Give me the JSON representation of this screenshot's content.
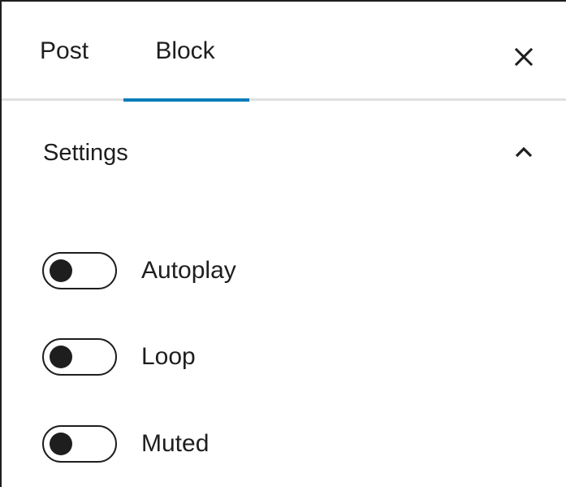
{
  "tabs": [
    {
      "label": "Post",
      "selected": false
    },
    {
      "label": "Block",
      "selected": true
    }
  ],
  "close_icon": "close-icon",
  "settings": {
    "title": "Settings",
    "expanded": true,
    "chevron_icon": "chevron-up-icon",
    "toggles": [
      {
        "label": "Autoplay",
        "checked": false
      },
      {
        "label": "Loop",
        "checked": false
      },
      {
        "label": "Muted",
        "checked": false
      }
    ]
  },
  "colors": {
    "accent": "#007cba",
    "text": "#1e1e1e",
    "divider": "#e0e0e0"
  }
}
